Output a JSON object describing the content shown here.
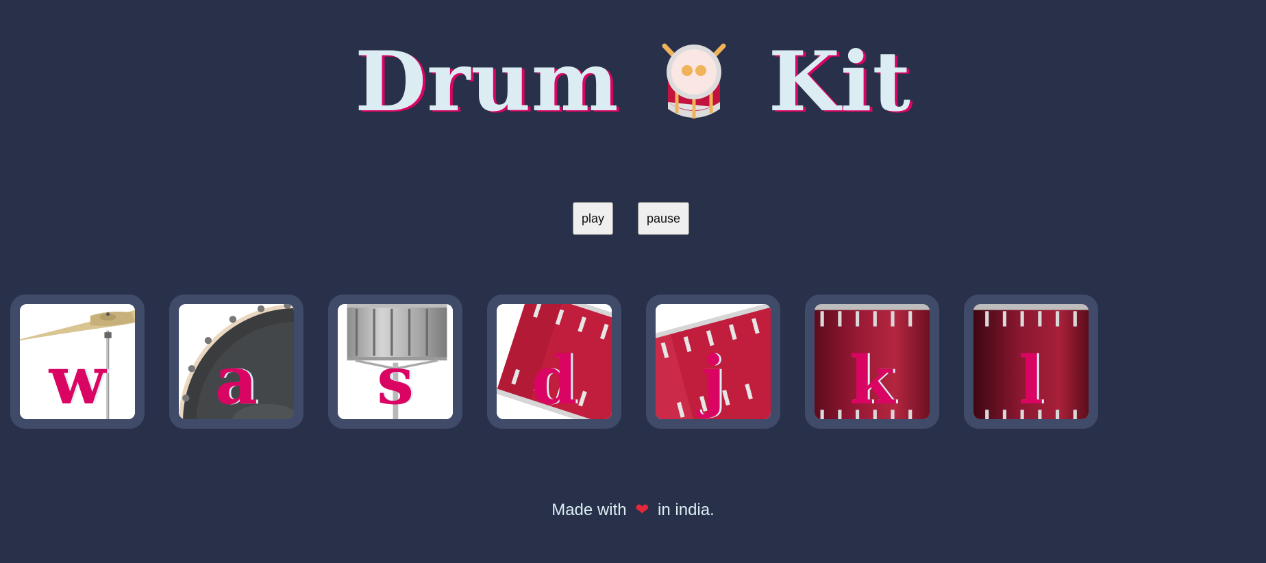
{
  "header": {
    "word_left": "Drum",
    "word_right": "Kit",
    "icon": "drum-icon"
  },
  "controls": {
    "play_label": "play",
    "pause_label": "pause"
  },
  "pads": [
    {
      "key": "w",
      "image": "crash-cymbal"
    },
    {
      "key": "a",
      "image": "bass-drum"
    },
    {
      "key": "s",
      "image": "snare-drum"
    },
    {
      "key": "d",
      "image": "tom-1"
    },
    {
      "key": "j",
      "image": "tom-2"
    },
    {
      "key": "k",
      "image": "tom-3"
    },
    {
      "key": "l",
      "image": "tom-4"
    }
  ],
  "footer": {
    "prefix": "Made with",
    "heart_icon": "heart-icon",
    "heart": "❤",
    "suffix": "in india."
  },
  "colors": {
    "background": "#283149",
    "pad_frame": "#404b69",
    "accent": "#da0463",
    "text_light": "#dbedf3",
    "drum_red": "#b3163c"
  }
}
